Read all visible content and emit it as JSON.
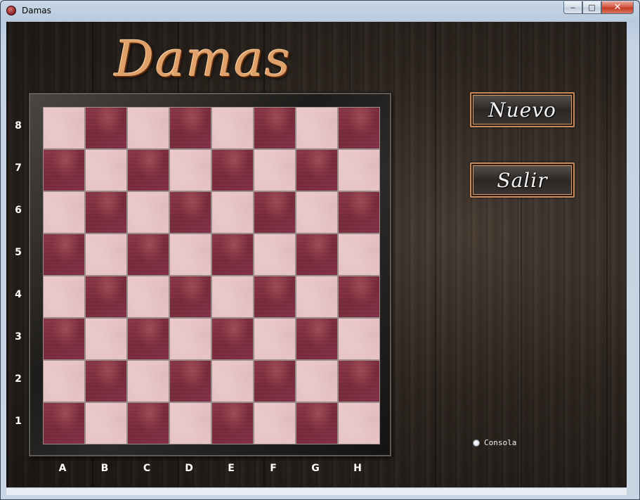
{
  "window": {
    "title": "Damas",
    "controls": {
      "minimize": "‒",
      "maximize": "□",
      "close": "✕"
    }
  },
  "game": {
    "logo": "Damas",
    "board": {
      "ranks": [
        "8",
        "7",
        "6",
        "5",
        "4",
        "3",
        "2",
        "1"
      ],
      "files": [
        "A",
        "B",
        "C",
        "D",
        "E",
        "F",
        "G",
        "H"
      ],
      "light_color": "#e6c2c3",
      "dark_color": "#83314a"
    },
    "buttons": {
      "new": "Nuevo",
      "exit": "Salir"
    },
    "console": {
      "label": "Consola",
      "checked": false
    }
  }
}
